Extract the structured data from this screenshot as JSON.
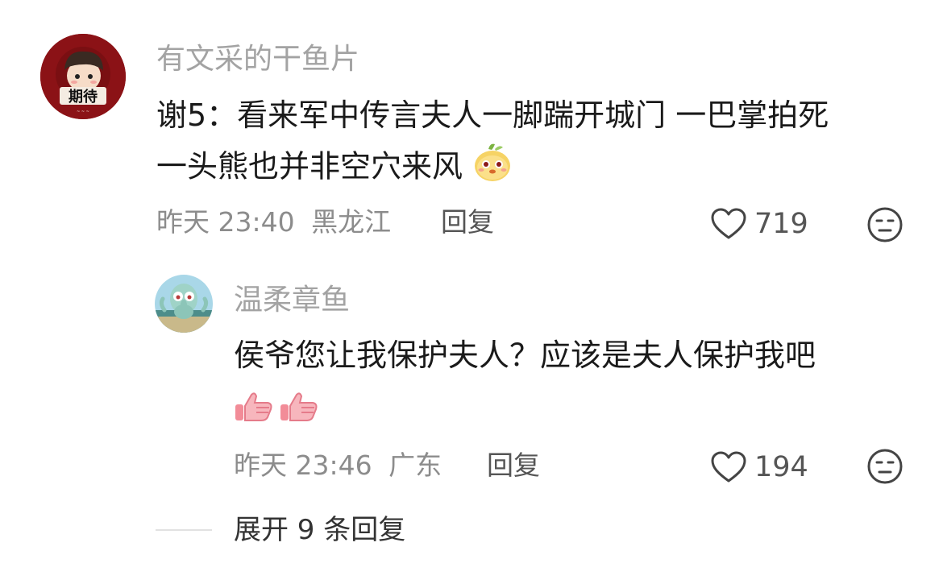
{
  "comments": [
    {
      "username": "有文采的干鱼片",
      "text": "谢5：看来军中传言夫人一脚踹开城门 一巴掌拍死一头熊也并非空穴来风",
      "line1": "谢5：看来军中传言夫人一脚踹开城门 一巴掌拍死",
      "line2": "一头熊也并非空穴来风",
      "emoji": "bean-smile-emoji",
      "time": "昨天 23:40",
      "location": "黑龙江",
      "reply_label": "回复",
      "likes": "719",
      "avatar_text": "期待"
    }
  ],
  "reply": {
    "username": "温柔章鱼",
    "text_line1": "侯爷您让我保护夫人？应该是夫人保护我吧",
    "emojis": [
      "thumbs-up-emoji",
      "thumbs-up-emoji"
    ],
    "time": "昨天 23:46",
    "location": "广东",
    "reply_label": "回复",
    "likes": "194"
  },
  "expand": {
    "label": "展开 9 条回复"
  },
  "colors": {
    "username": "#a3a3a3",
    "text": "#1a1a1a",
    "meta": "#8c8c8c",
    "avatar_bg": "#8b1216"
  }
}
